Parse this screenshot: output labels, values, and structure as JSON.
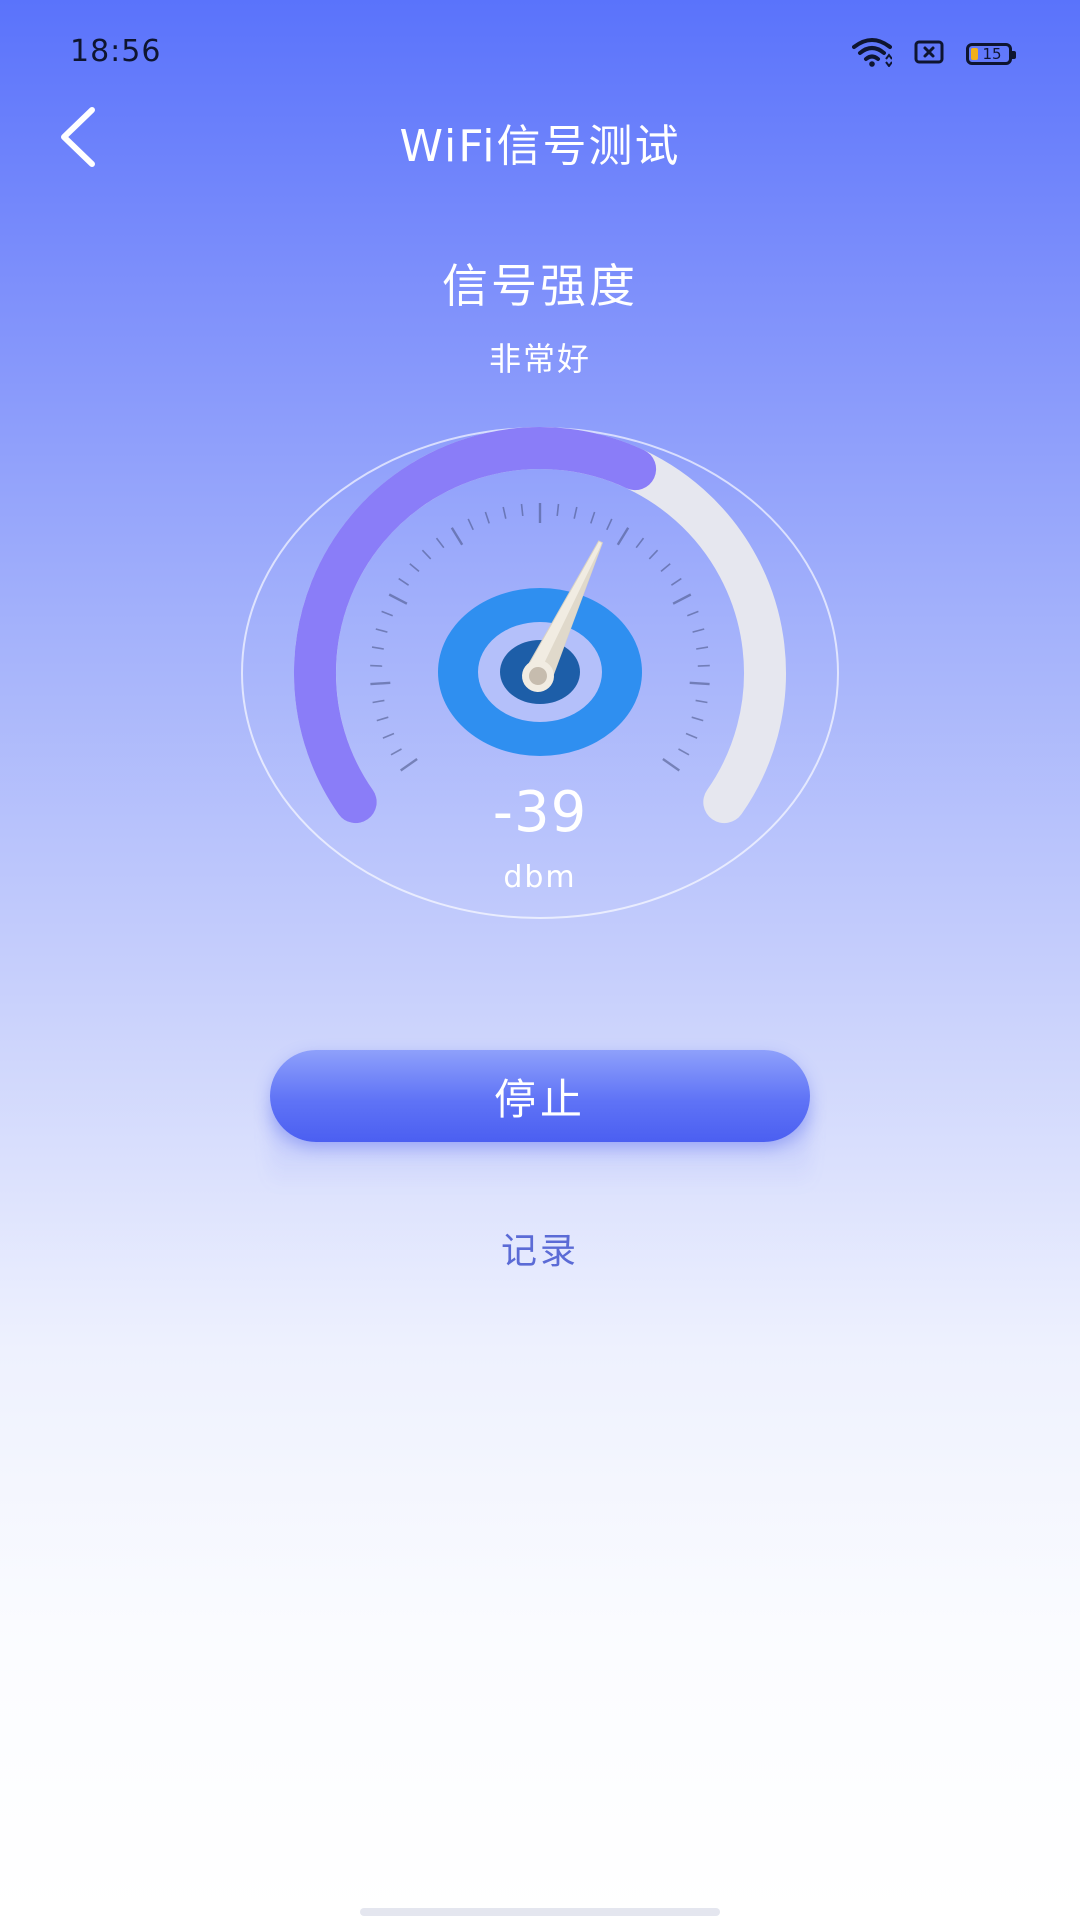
{
  "status_bar": {
    "time": "18:56",
    "battery_level": "15",
    "icons": [
      "wifi-icon",
      "sim-card-icon",
      "battery-icon"
    ]
  },
  "header": {
    "title": "WiFi信号测试",
    "back_icon": "chevron-left-icon"
  },
  "signal": {
    "label": "信号强度",
    "quality": "非常好",
    "value": "-39",
    "unit": "dbm",
    "gauge_fill_fraction": 0.6
  },
  "actions": {
    "stop_label": "停止",
    "records_label": "记录"
  },
  "colors": {
    "accent": "#5f73f6",
    "gauge_fill": "#8a7df8",
    "gauge_track": "#e6e7ef",
    "hub_blue": "#2f8ff0",
    "hub_dark": "#1d5ea8",
    "link": "#5b6bd6"
  }
}
